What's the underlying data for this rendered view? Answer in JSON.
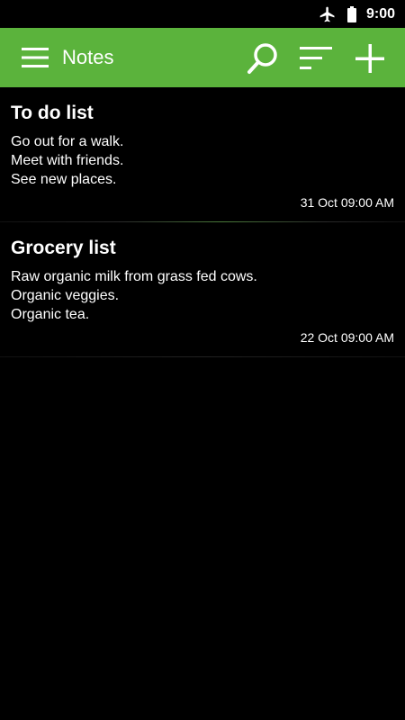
{
  "status_bar": {
    "time": "9:00",
    "icons": [
      "airplane-icon",
      "battery-icon"
    ]
  },
  "app_bar": {
    "title": "Notes",
    "background_color": "#5bb33c",
    "icons": [
      "menu-icon",
      "search-icon",
      "sort-icon",
      "add-icon"
    ]
  },
  "notes": [
    {
      "title": "To do list",
      "lines": [
        "Go out for a walk.",
        "Meet with friends.",
        "See new places."
      ],
      "date": "31 Oct 09:00 AM"
    },
    {
      "title": "Grocery list",
      "lines": [
        "Raw organic milk from grass fed cows.",
        "Organic veggies.",
        "Organic tea."
      ],
      "date": "22 Oct 09:00 AM"
    }
  ]
}
